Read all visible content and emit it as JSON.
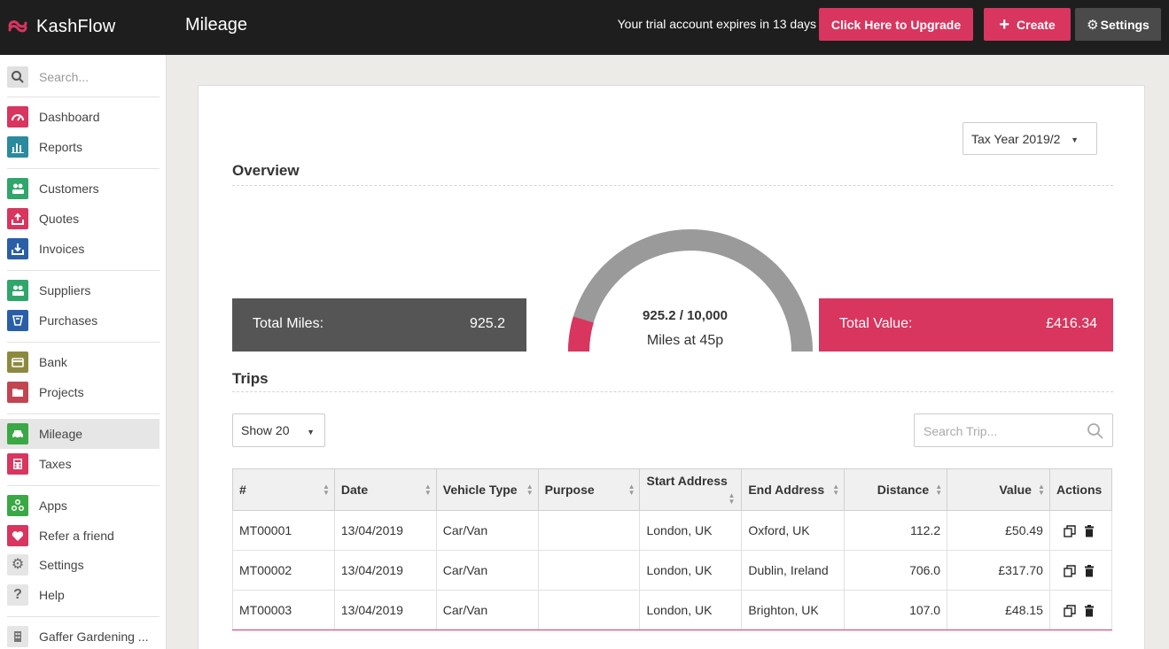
{
  "app": {
    "name": "KashFlow",
    "page_title": "Mileage",
    "trial_notice": "Your trial account expires in 13 days",
    "upgrade_label": "Click Here to Upgrade",
    "create_label": "Create",
    "settings_label": "Settings",
    "brand_color": "#d8355f"
  },
  "sidebar": {
    "search_placeholder": "Search...",
    "items": [
      {
        "label": "Dashboard",
        "icon": "speedometer-icon",
        "color": "#d8355f"
      },
      {
        "label": "Reports",
        "icon": "bar-chart-icon",
        "color": "#2b8a9e"
      },
      {
        "label": "Customers",
        "icon": "users-icon",
        "color": "#2fa66a"
      },
      {
        "label": "Quotes",
        "icon": "tray-upload-icon",
        "color": "#d8355f"
      },
      {
        "label": "Invoices",
        "icon": "tray-download-icon",
        "color": "#2a5fa8"
      },
      {
        "label": "Suppliers",
        "icon": "users-icon",
        "color": "#2fa66a"
      },
      {
        "label": "Purchases",
        "icon": "purchases-icon",
        "color": "#2a5fa8"
      },
      {
        "label": "Bank",
        "icon": "bank-card-icon",
        "color": "#8c8a3e"
      },
      {
        "label": "Projects",
        "icon": "folder-icon",
        "color": "#c2454f"
      },
      {
        "label": "Mileage",
        "icon": "car-icon",
        "color": "#3aa845"
      },
      {
        "label": "Taxes",
        "icon": "calculator-icon",
        "color": "#d8355f"
      },
      {
        "label": "Apps",
        "icon": "apps-icon",
        "color": "#3aa845"
      },
      {
        "label": "Refer a friend",
        "icon": "heart-icon",
        "color": "#d8355f"
      },
      {
        "label": "Settings",
        "icon": "gear-icon",
        "color": "#777777"
      },
      {
        "label": "Help",
        "icon": "question-icon",
        "color": "#777777"
      },
      {
        "label": "Gaffer Gardening ...",
        "icon": "building-icon",
        "color": "#777777"
      }
    ]
  },
  "main": {
    "tax_year": "Tax Year 2019/2",
    "overview_title": "Overview",
    "total_miles_label": "Total Miles:",
    "total_miles_value": "925.2",
    "total_value_label": "Total Value:",
    "total_value_value": "£416.34",
    "gauge_text": "925.2 / 10,000",
    "gauge_sub": "Miles at 45p",
    "gauge_fraction": 0.0925,
    "trips_title": "Trips",
    "show_select": "Show 20",
    "search_placeholder": "Search Trip...",
    "columns": [
      "#",
      "Date",
      "Vehicle Type",
      "Purpose",
      "Start Address",
      "End Address",
      "Distance",
      "Value",
      "Actions"
    ],
    "rows": [
      {
        "id": "MT00001",
        "date": "13/04/2019",
        "vehicle": "Car/Van",
        "purpose": "",
        "start": "London, UK",
        "end": "Oxford, UK",
        "distance": "112.2",
        "value": "£50.49"
      },
      {
        "id": "MT00002",
        "date": "13/04/2019",
        "vehicle": "Car/Van",
        "purpose": "",
        "start": "London, UK",
        "end": "Dublin, Ireland",
        "distance": "706.0",
        "value": "£317.70"
      },
      {
        "id": "MT00003",
        "date": "13/04/2019",
        "vehicle": "Car/Van",
        "purpose": "",
        "start": "London, UK",
        "end": "Brighton, UK",
        "distance": "107.0",
        "value": "£48.15"
      }
    ]
  }
}
